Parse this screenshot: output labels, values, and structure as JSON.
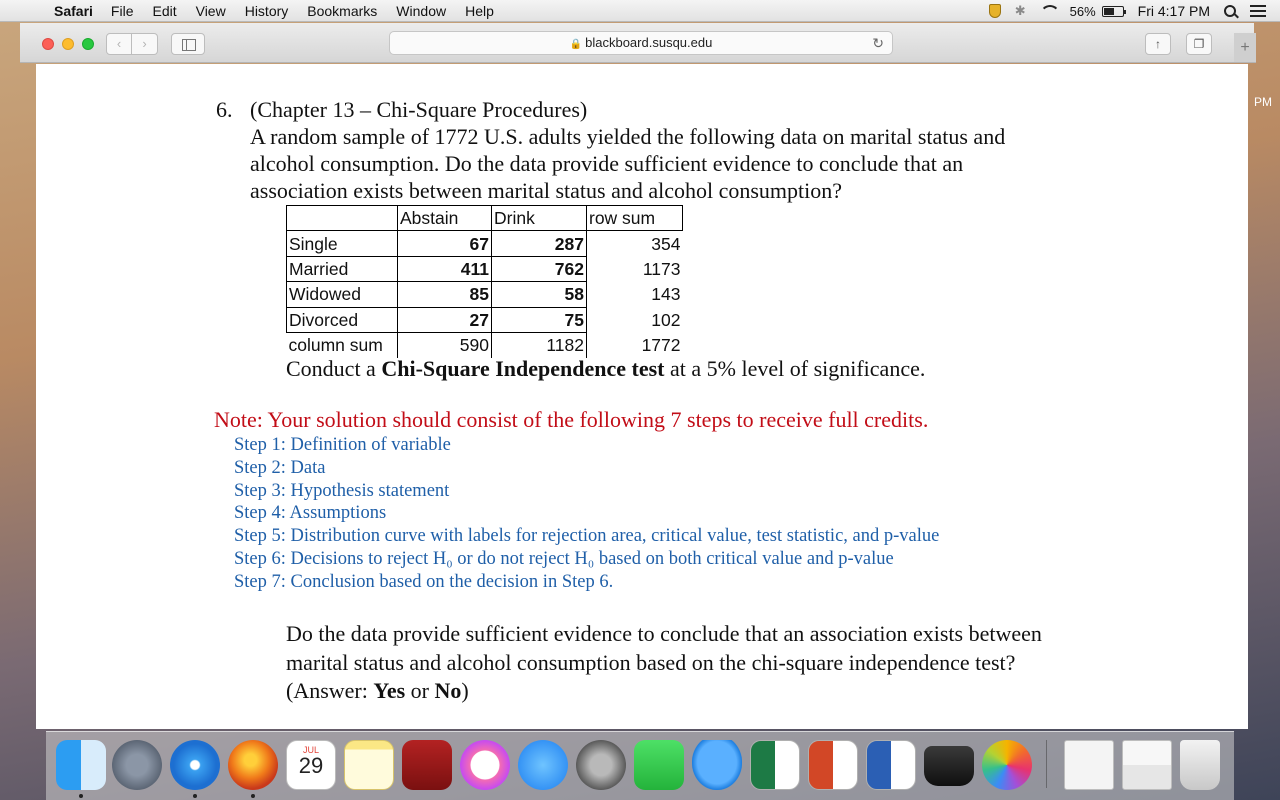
{
  "menubar": {
    "app": "Safari",
    "menus": [
      "File",
      "Edit",
      "View",
      "History",
      "Bookmarks",
      "Window",
      "Help"
    ],
    "battery": "56%",
    "battery_level": 0.56,
    "clock": "Fri 4:17 PM"
  },
  "browser": {
    "url": "blackboard.susqu.edu"
  },
  "peek": {
    "text": "PM"
  },
  "problem": {
    "number": "6.",
    "lines": [
      "(Chapter 13 – Chi-Square Procedures)",
      "A random sample of 1772 U.S. adults yielded the following data on marital status and",
      "alcohol consumption. Do the data provide sufficient evidence to conclude that an",
      "association exists between marital status and alcohol consumption?"
    ],
    "table": {
      "headers": [
        "",
        "Abstain",
        "Drink",
        "row sum"
      ],
      "rows": [
        [
          "Single",
          "67",
          "287",
          "354"
        ],
        [
          "Married",
          "411",
          "762",
          "1173"
        ],
        [
          "Widowed",
          "85",
          "58",
          "143"
        ],
        [
          "Divorced",
          "27",
          "75",
          "102"
        ]
      ],
      "footer": [
        "column sum",
        "590",
        "1182",
        "1772"
      ]
    },
    "conduct": {
      "pre": "Conduct a ",
      "bold": "Chi-Square Independence test",
      "post": " at a 5% level of significance."
    }
  },
  "note": {
    "title": "Note: Your solution should consist of the following 7 steps to receive full credits.",
    "steps": [
      "Step 1: Definition of variable",
      "Step 2: Data",
      "Step 3: Hypothesis statement",
      "Step 4: Assumptions",
      "Step 5: Distribution curve with labels for rejection area, critical value, test statistic, and p-value",
      "Step 6: Decisions to reject H₀ or do not reject H₀ based on both critical value and p-value",
      "Step 7: Conclusion based on the decision in Step 6."
    ]
  },
  "question": {
    "line1": "Do the data provide sufficient evidence to conclude that an association exists between",
    "line2": "marital status and alcohol consumption based on the chi-square independence test?",
    "answer_pre": "(Answer: ",
    "yes": "Yes",
    "or": " or ",
    "no": "No",
    "answer_post": ")"
  },
  "dock": {
    "calendar_month": "JUL",
    "calendar_day": "29",
    "apps": [
      "finder",
      "launchpad",
      "safari",
      "firefox",
      "calendar",
      "notes",
      "photo-booth",
      "itunes",
      "app-store",
      "system-preferences",
      "facetime",
      "messages",
      "excel",
      "powerpoint",
      "word",
      "printer",
      "photos",
      "documents",
      "downloads",
      "trash"
    ]
  }
}
